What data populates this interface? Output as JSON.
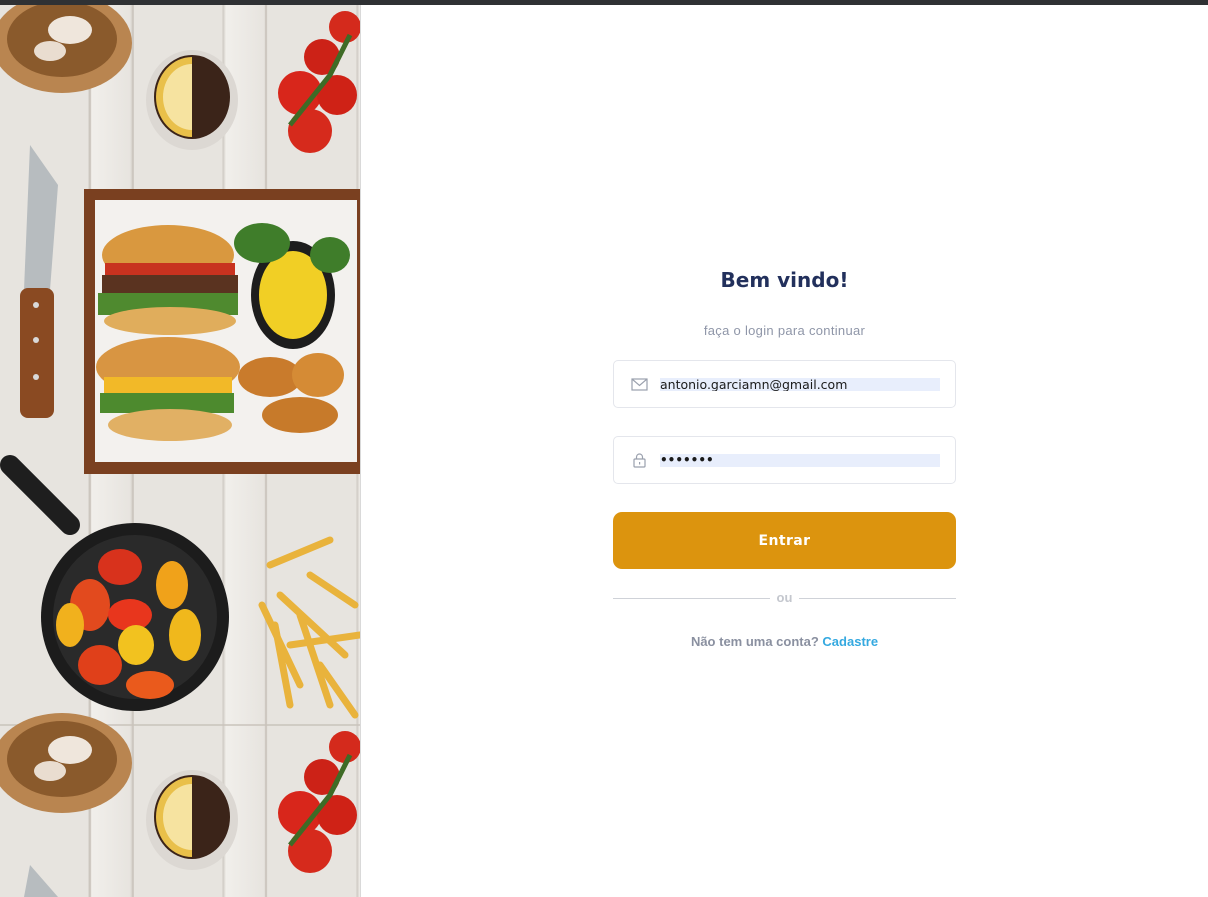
{
  "login": {
    "title": "Bem vindo!",
    "subtitle": "faça o login para continuar",
    "email_value": "antonio.garciamn@gmail.com",
    "email_icon": "mail-icon",
    "password_value": "•••••••",
    "password_icon": "lock-icon",
    "submit_label": "Entrar",
    "divider_text": "ou",
    "signup_question": "Não tem uma conta?",
    "signup_link": "Cadastre"
  },
  "colors": {
    "title": "#22305c",
    "button": "#dc940e",
    "link": "#35a9e0",
    "autofill": "#e8eefc"
  }
}
